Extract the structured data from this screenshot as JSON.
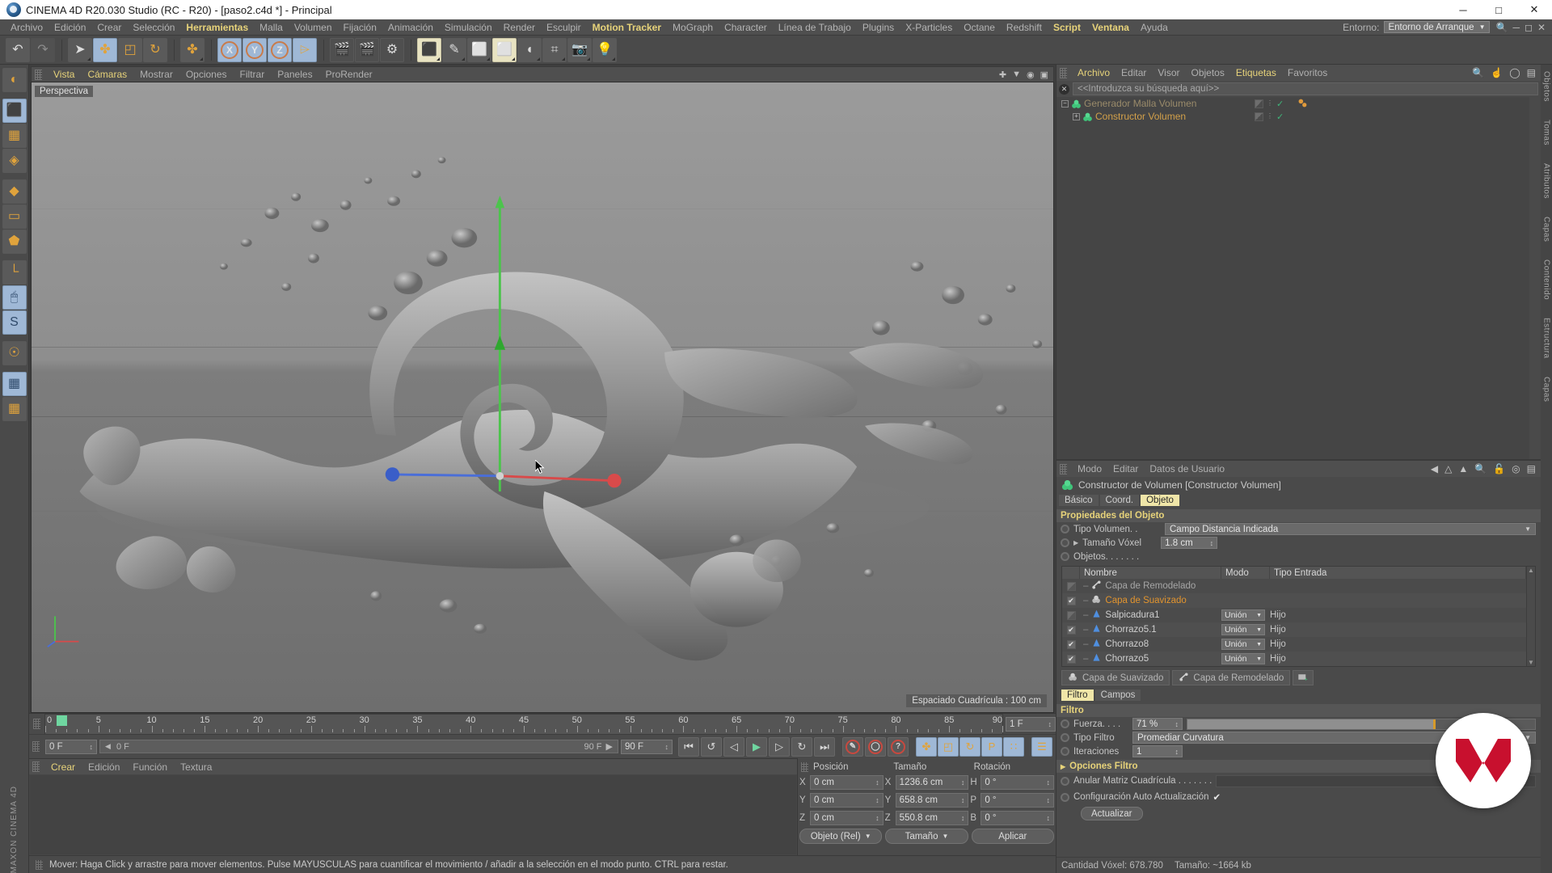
{
  "titlebar": {
    "title": "CINEMA 4D R20.030 Studio (RC - R20) - [paso2.c4d *] - Principal",
    "minimize": "─",
    "maximize": "□",
    "close": "✕",
    "app_icon": "cinema4d-logo-icon"
  },
  "menubar": {
    "items": [
      {
        "label": "Archivo",
        "highlight": false
      },
      {
        "label": "Edición",
        "highlight": false
      },
      {
        "label": "Crear",
        "highlight": false
      },
      {
        "label": "Selección",
        "highlight": false
      },
      {
        "label": "Herramientas",
        "highlight": true
      },
      {
        "label": "Malla",
        "highlight": false
      },
      {
        "label": "Volumen",
        "highlight": false
      },
      {
        "label": "Fijación",
        "highlight": false
      },
      {
        "label": "Animación",
        "highlight": false
      },
      {
        "label": "Simulación",
        "highlight": false
      },
      {
        "label": "Render",
        "highlight": false
      },
      {
        "label": "Esculpir",
        "highlight": false
      },
      {
        "label": "Motion Tracker",
        "highlight": true
      },
      {
        "label": "MoGraph",
        "highlight": false
      },
      {
        "label": "Character",
        "highlight": false
      },
      {
        "label": "Línea de Trabajo",
        "highlight": false
      },
      {
        "label": "Plugins",
        "highlight": false
      },
      {
        "label": "X-Particles",
        "highlight": false
      },
      {
        "label": "Octane",
        "highlight": false
      },
      {
        "label": "Redshift",
        "highlight": false
      },
      {
        "label": "Script",
        "highlight": true
      },
      {
        "label": "Ventana",
        "highlight": true
      },
      {
        "label": "Ayuda",
        "highlight": false
      }
    ],
    "env_label": "Entorno:",
    "env_value": "Entorno de Arranque",
    "env_caret": "▼",
    "search_icon": "search-icon"
  },
  "toolbar": {
    "groups": [
      {
        "buttons": [
          {
            "name": "undo-button",
            "glyph": "↶",
            "state": "normal"
          },
          {
            "name": "redo-button",
            "glyph": "↷",
            "state": "disabled"
          }
        ]
      },
      {
        "buttons": [
          {
            "name": "select-tool-button",
            "glyph": "➤",
            "state": "normal",
            "corner": true
          },
          {
            "name": "move-tool-button",
            "glyph": "✤",
            "state": "selected"
          },
          {
            "name": "scale-tool-button",
            "glyph": "◰",
            "state": "normal"
          },
          {
            "name": "rotate-tool-button",
            "glyph": "↻",
            "state": "normal"
          }
        ]
      },
      {
        "buttons": [
          {
            "name": "world-axis-button",
            "glyph": "✤",
            "state": "normal",
            "corner": true
          }
        ]
      },
      {
        "buttons": [
          {
            "name": "lock-x-axis-button",
            "glyph": "X",
            "state": "selected"
          },
          {
            "name": "lock-y-axis-button",
            "glyph": "Y",
            "state": "selected"
          },
          {
            "name": "lock-z-axis-button",
            "glyph": "Z",
            "state": "selected"
          },
          {
            "name": "world-object-coords-button",
            "glyph": "⌲",
            "state": "selected"
          }
        ]
      },
      {
        "buttons": [
          {
            "name": "render-view-button",
            "glyph": "🎬",
            "state": "dark"
          },
          {
            "name": "render-region-button",
            "glyph": "🎬",
            "state": "dark"
          },
          {
            "name": "render-settings-button",
            "glyph": "⚙",
            "state": "dark"
          }
        ]
      },
      {
        "buttons": [
          {
            "name": "add-primitive-button",
            "glyph": "⬛",
            "state": "cream",
            "corner": true
          },
          {
            "name": "spline-pen-button",
            "glyph": "✎",
            "state": "normal",
            "corner": true
          },
          {
            "name": "generators-button",
            "glyph": "⬜",
            "state": "normal",
            "corner": true
          },
          {
            "name": "array-button",
            "glyph": "⬜",
            "state": "cream",
            "corner": true
          },
          {
            "name": "deformers-button",
            "glyph": "◖",
            "state": "normal",
            "corner": true
          },
          {
            "name": "scene-floor-button",
            "glyph": "⌗",
            "state": "normal",
            "corner": true
          },
          {
            "name": "camera-button",
            "glyph": "📷",
            "state": "normal",
            "corner": true
          },
          {
            "name": "light-button",
            "glyph": "💡",
            "state": "normal",
            "corner": true
          }
        ]
      }
    ]
  },
  "leftbar": {
    "buttons": [
      {
        "name": "render-preview-button",
        "glyph": "◐",
        "state": "normal"
      },
      {
        "name": "model-mode-button",
        "glyph": "⬛",
        "state": "selected",
        "corner": true
      },
      {
        "name": "texture-mode-button",
        "glyph": "▦",
        "state": "normal"
      },
      {
        "name": "workplane-mode-button",
        "glyph": "◈",
        "state": "normal"
      },
      {
        "name": "point-mode-button",
        "glyph": "◆",
        "state": "normal"
      },
      {
        "name": "edge-mode-button",
        "glyph": "▭",
        "state": "normal"
      },
      {
        "name": "polygon-mode-button",
        "glyph": "⬟",
        "state": "normal"
      },
      {
        "name": "axis-mode-button",
        "glyph": "└",
        "state": "normal"
      },
      {
        "name": "viewport-solo-button",
        "glyph": "🖱",
        "state": "selected"
      },
      {
        "name": "soft-selection-button",
        "glyph": "S",
        "state": "selected",
        "corner": true
      },
      {
        "name": "snap-magnet-button",
        "glyph": "☉",
        "state": "normal",
        "corner": true
      },
      {
        "name": "lock-workplane-button",
        "glyph": "▦",
        "state": "selected"
      },
      {
        "name": "planar-workplane-button",
        "glyph": "▦",
        "state": "normal"
      }
    ],
    "brand": "MAXON CINEMA 4D"
  },
  "viewport": {
    "menu": [
      {
        "label": "Vista",
        "highlight": true
      },
      {
        "label": "Cámaras",
        "highlight": true
      },
      {
        "label": "Mostrar",
        "highlight": false
      },
      {
        "label": "Opciones",
        "highlight": false
      },
      {
        "label": "Filtrar",
        "highlight": false
      },
      {
        "label": "Paneles",
        "highlight": false
      },
      {
        "label": "ProRender",
        "highlight": false
      }
    ],
    "icons": [
      "move-view-icon",
      "scale-view-icon",
      "rotate-view-icon",
      "maximize-view-icon"
    ],
    "label": "Perspectiva",
    "grid_spacing": "Espaciado Cuadrícula : 100 cm",
    "scene_description": "Liquid splash 3D simulation over grey gradient horizon"
  },
  "timeline": {
    "ticks": [
      0,
      5,
      10,
      15,
      20,
      25,
      30,
      35,
      40,
      45,
      50,
      55,
      60,
      65,
      70,
      75,
      80,
      85,
      90
    ],
    "start_label": "0",
    "playhead_frame": "0",
    "end_field": "1 F",
    "current_frame": "0 F",
    "range_start": "0 F",
    "range_end": "90 F",
    "range_end_box": "90 F"
  },
  "transport": {
    "buttons": [
      {
        "name": "go-to-start-button",
        "glyph": "⏮"
      },
      {
        "name": "previous-keyframe-button",
        "glyph": "↺"
      },
      {
        "name": "step-back-button",
        "glyph": "◁"
      },
      {
        "name": "play-button",
        "glyph": "▶"
      },
      {
        "name": "step-forward-button",
        "glyph": "▷"
      },
      {
        "name": "next-keyframe-button",
        "glyph": "↻"
      },
      {
        "name": "go-to-end-button",
        "glyph": "⏭"
      }
    ],
    "record_buttons": [
      {
        "name": "record-keyframe-button",
        "glyph": "✎"
      },
      {
        "name": "autokey-button",
        "glyph": "◯"
      },
      {
        "name": "keyframe-selection-button",
        "glyph": "?"
      }
    ],
    "key_toggles": [
      {
        "name": "position-key-button",
        "glyph": "✤",
        "state": "selected"
      },
      {
        "name": "scale-key-button",
        "glyph": "◰",
        "state": "selected"
      },
      {
        "name": "rotation-key-button",
        "glyph": "↻",
        "state": "selected"
      },
      {
        "name": "parameter-key-button",
        "glyph": "P",
        "state": "selected"
      },
      {
        "name": "point-level-key-button",
        "glyph": "∷",
        "state": "selected"
      }
    ],
    "extra": [
      {
        "name": "timeline-toggle-button",
        "glyph": "☰",
        "state": "selected"
      }
    ]
  },
  "material_manager": {
    "menu": [
      {
        "label": "Crear",
        "highlight": true
      },
      {
        "label": "Edición",
        "highlight": false
      },
      {
        "label": "Función",
        "highlight": false
      },
      {
        "label": "Textura",
        "highlight": false
      }
    ]
  },
  "coordinates": {
    "headers": [
      "Posición",
      "Tamaño",
      "Rotación"
    ],
    "rows": [
      {
        "axis1": "X",
        "pos": "0 cm",
        "axis2": "X",
        "size": "1236.6 cm",
        "axis3": "H",
        "rot": "0 °"
      },
      {
        "axis1": "Y",
        "pos": "0 cm",
        "axis2": "Y",
        "size": "658.8 cm",
        "axis3": "P",
        "rot": "0 °"
      },
      {
        "axis1": "Z",
        "pos": "0 cm",
        "axis2": "Z",
        "size": "550.8 cm",
        "axis3": "B",
        "rot": "0 °"
      }
    ],
    "mode_button": "Objeto (Rel)",
    "size_button": "Tamaño",
    "apply_button": "Aplicar",
    "caret": "▼"
  },
  "statusbar": {
    "text": "Mover: Haga Click y arrastre para mover elementos. Pulse MAYUSCULAS para cuantificar el movimiento / añadir a la selección en el modo punto. CTRL para restar."
  },
  "object_manager": {
    "menu": [
      {
        "label": "Archivo",
        "highlight": true
      },
      {
        "label": "Editar",
        "highlight": false
      },
      {
        "label": "Visor",
        "highlight": false
      },
      {
        "label": "Objetos",
        "highlight": false
      },
      {
        "label": "Etiquetas",
        "highlight": true
      },
      {
        "label": "Favoritos",
        "highlight": false
      }
    ],
    "icons": [
      "search-icon",
      "home-icon",
      "ellipse-icon",
      "layout-icon"
    ],
    "search_placeholder": "<<Introduzca su búsqueda aquí>>",
    "clear_icon": "close-icon",
    "items": [
      {
        "name": "Generador Malla Volumen",
        "icon": "volume-mesher-icon",
        "expander": "−",
        "indent": 0,
        "dim": true,
        "visible": "✓",
        "has_tag": true
      },
      {
        "name": "Constructor Volumen",
        "icon": "volume-builder-icon",
        "expander": "+",
        "indent": 1,
        "dim": false,
        "visible": "✓",
        "has_tag": false
      }
    ]
  },
  "attribute_manager": {
    "menu": [
      {
        "label": "Modo",
        "highlight": false
      },
      {
        "label": "Editar",
        "highlight": false
      },
      {
        "label": "Datos de Usuario",
        "highlight": false
      }
    ],
    "icons": [
      "back-icon",
      "forward-icon",
      "up-icon",
      "search-icon",
      "lock-icon",
      "target-icon",
      "layout-icon"
    ],
    "object_title": "Constructor de Volumen [Constructor Volumen]",
    "object_icon": "volume-builder-icon",
    "tabs": [
      {
        "label": "Básico",
        "selected": false
      },
      {
        "label": "Coord.",
        "selected": false
      },
      {
        "label": "Objeto",
        "selected": true
      }
    ],
    "section_title": "Propiedades del Objeto",
    "volume_type_label": "Tipo Volumen. .",
    "volume_type_value": "Campo Distancia Indicada",
    "voxel_size_label": "Tamaño Vóxel",
    "voxel_size_value": "1.8 cm",
    "objects_label": "Objetos. . . . . . .",
    "table": {
      "headers": [
        "Nombre",
        "Modo",
        "Tipo Entrada"
      ],
      "rows": [
        {
          "checked": false,
          "name": "Capa de Remodelado",
          "icon": "reshape-layer-icon",
          "mode": "",
          "type": "",
          "selected": false,
          "dim": true
        },
        {
          "checked": true,
          "name": "Capa de Suavizado",
          "icon": "smooth-layer-icon",
          "mode": "",
          "type": "",
          "selected": true,
          "dim": false
        },
        {
          "checked": false,
          "name": "Salpicadura1",
          "icon": "cone-icon",
          "mode": "Unión",
          "type": "Hijo",
          "selected": false,
          "dim": false
        },
        {
          "checked": true,
          "name": "Chorrazo5.1",
          "icon": "cone-icon",
          "mode": "Unión",
          "type": "Hijo",
          "selected": false,
          "dim": false
        },
        {
          "checked": true,
          "name": "Chorrazo8",
          "icon": "cone-icon",
          "mode": "Unión",
          "type": "Hijo",
          "selected": false,
          "dim": false
        },
        {
          "checked": true,
          "name": "Chorrazo5",
          "icon": "cone-icon",
          "mode": "Unión",
          "type": "Hijo",
          "selected": false,
          "dim": false
        }
      ],
      "mode_caret": "▼"
    },
    "layer_chips": [
      {
        "label": "Capa de Suavizado",
        "icon": "smooth-layer-icon"
      },
      {
        "label": "Capa de Remodelado",
        "icon": "reshape-layer-icon"
      },
      {
        "label": "",
        "icon": "add-layer-icon"
      }
    ],
    "filter_tabs": [
      {
        "label": "Filtro",
        "selected": true
      },
      {
        "label": "Campos",
        "selected": false
      }
    ],
    "filter_section_title": "Filtro",
    "strength_label": "Fuerza. . . .",
    "strength_value": "71 %",
    "strength_percent": 71,
    "filter_type_label": "Tipo Filtro",
    "filter_type_value": "Promediar Curvatura",
    "iterations_label": "Iteraciones",
    "iterations_value": "1",
    "filter_options_title": "Opciones Filtro",
    "filter_options_caret": "▶",
    "override_grid_label": "Anular Matriz Cuadrícula . . . . . . .",
    "override_grid_value": "",
    "auto_update_label": "Configuración Auto Actualización",
    "auto_update_checked": "✔",
    "update_button": "Actualizar",
    "voxel_count_label": "Cantidad Vóxel: 678.780",
    "voxel_size_info": "Tamaño: ~1664 kb"
  },
  "edge_tabs_right": [
    "Objetos",
    "Tomas"
  ],
  "edge_tabs_right2": [
    "Atributos",
    "Capas"
  ],
  "edge_tabs_far": [
    "Contenido",
    "Estructura",
    "Capas"
  ],
  "maxon_badge": {
    "name": "maxon-logo",
    "color": "#c8102e"
  },
  "colors": {
    "accent_yellow": "#e7d37a",
    "orange_text": "#d2a04a",
    "selection_blue": "#9fb8d6",
    "tab_active": "#f0e6a8",
    "green_check": "#3fb67a",
    "maxon_red": "#c8102e"
  }
}
